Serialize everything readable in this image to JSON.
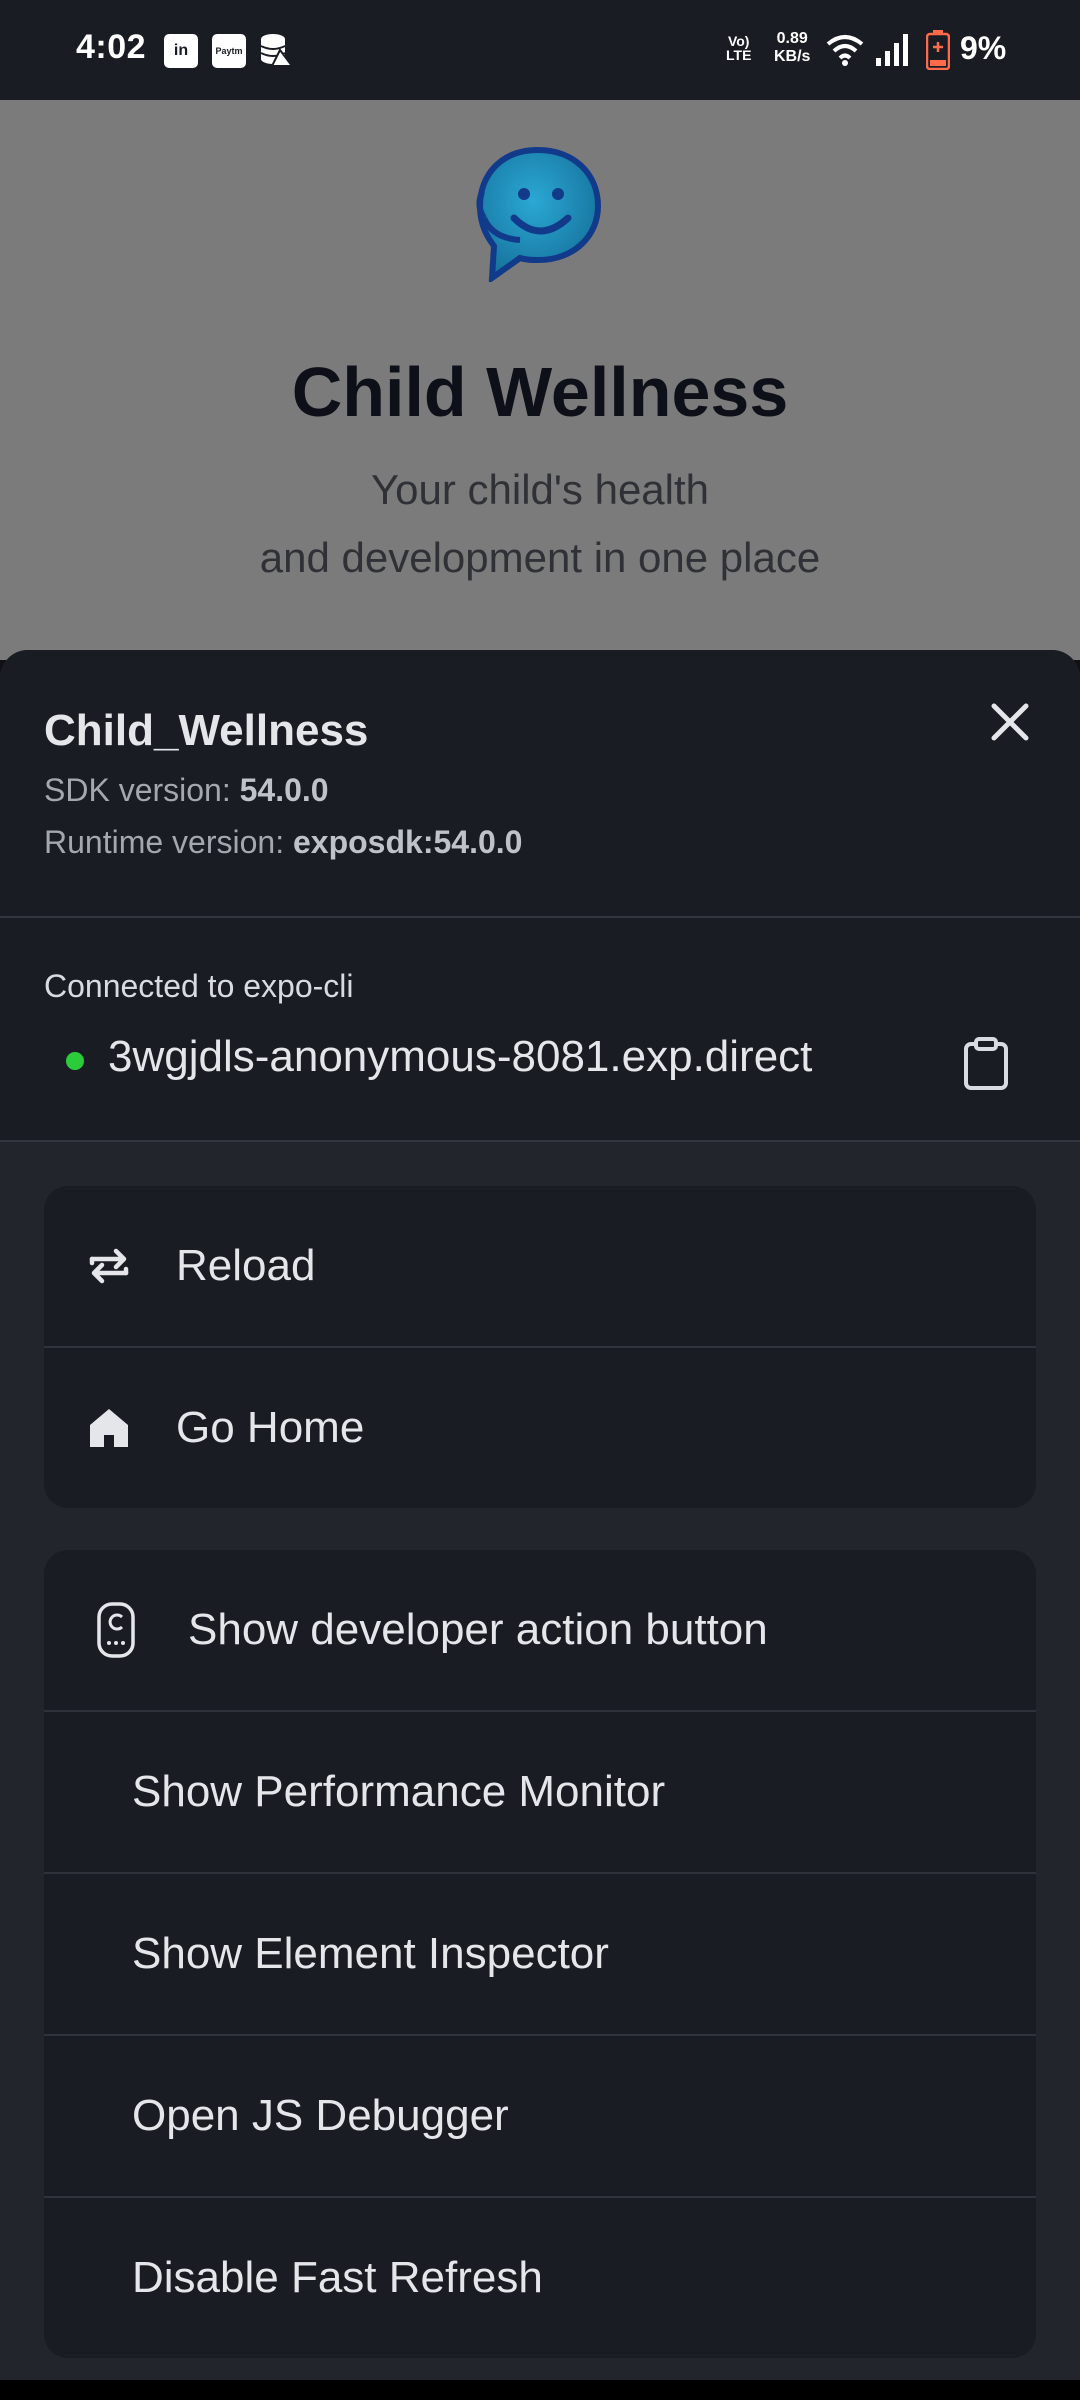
{
  "status_bar": {
    "time": "4:02",
    "network_lte_top": "Vo)",
    "network_lte_bottom": "LTE",
    "speed_top": "0.89",
    "speed_bottom": "KB/s",
    "battery": "9%",
    "notification_icons": [
      "linkedin-icon",
      "paytm-icon",
      "database-alert-icon"
    ]
  },
  "app": {
    "title": "Child Wellness",
    "subtitle_line1": "Your child's health",
    "subtitle_line2": "and development in one place",
    "logo_icon": "chat-smile-icon"
  },
  "dev_menu": {
    "app_name": "Child_Wellness",
    "sdk_label": "SDK version: ",
    "sdk_value": "54.0.0",
    "runtime_label": "Runtime version: ",
    "runtime_value": "exposdk:54.0.0",
    "connected_label": "Connected to expo-cli",
    "url": "3wgjdls-anonymous-8081.exp.direct",
    "group1": [
      {
        "label": "Reload",
        "icon": "reload-icon"
      },
      {
        "label": "Go Home",
        "icon": "home-icon"
      }
    ],
    "group2": [
      {
        "label": "Show developer action button",
        "icon": "remote-icon"
      },
      {
        "label": "Show Performance Monitor"
      },
      {
        "label": "Show Element Inspector"
      },
      {
        "label": "Open JS Debugger"
      },
      {
        "label": "Disable Fast Refresh"
      }
    ]
  },
  "colors": {
    "sheet_bg": "#22252c",
    "card_bg": "#191c22",
    "accent_green": "#2bcc3a",
    "logo_blue": "#1a8fc0"
  }
}
